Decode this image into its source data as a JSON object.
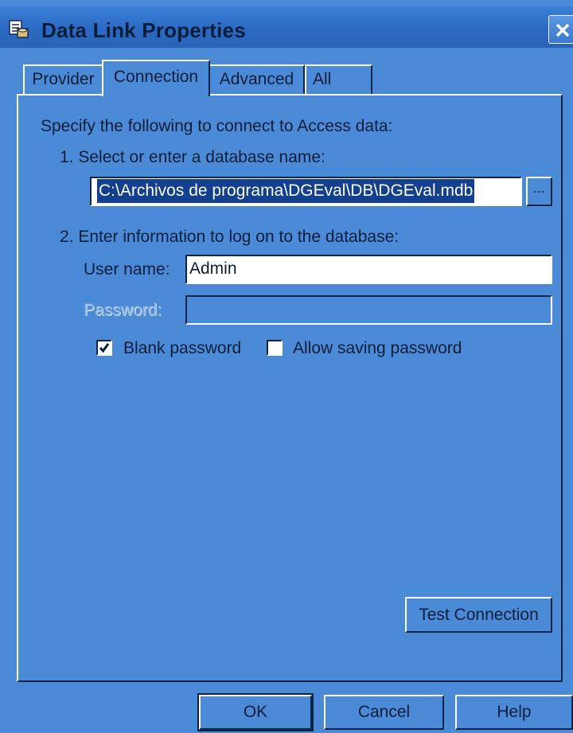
{
  "window": {
    "title": "Data Link Properties",
    "close_glyph": "X",
    "icon": "data-link-icon"
  },
  "tabs": [
    {
      "label": "Provider",
      "selected": false
    },
    {
      "label": "Connection",
      "selected": true
    },
    {
      "label": "Advanced",
      "selected": false
    },
    {
      "label": "All",
      "selected": false
    }
  ],
  "connection": {
    "intro": "Specify the following to connect to Access data:",
    "step1_label": "1. Select or enter a database name:",
    "database_path": "C:\\Archivos de programa\\DGEval\\DB\\DGEval.mdb",
    "browse_label": "...",
    "step2_label": "2. Enter information to log on to the database:",
    "username_label": "User name:",
    "username_value": "Admin",
    "password_label": "Password:",
    "password_value": "",
    "blank_password_label": "Blank password",
    "blank_password_checked": true,
    "allow_saving_label": "Allow saving password",
    "allow_saving_checked": false,
    "test_connection_label": "Test Connection"
  },
  "footer": {
    "ok_label": "OK",
    "cancel_label": "Cancel",
    "help_label": "Help"
  },
  "colors": {
    "window_bg": "#4a8ad6",
    "titlebar": "#2a69c2",
    "selection": "#123f8e"
  }
}
